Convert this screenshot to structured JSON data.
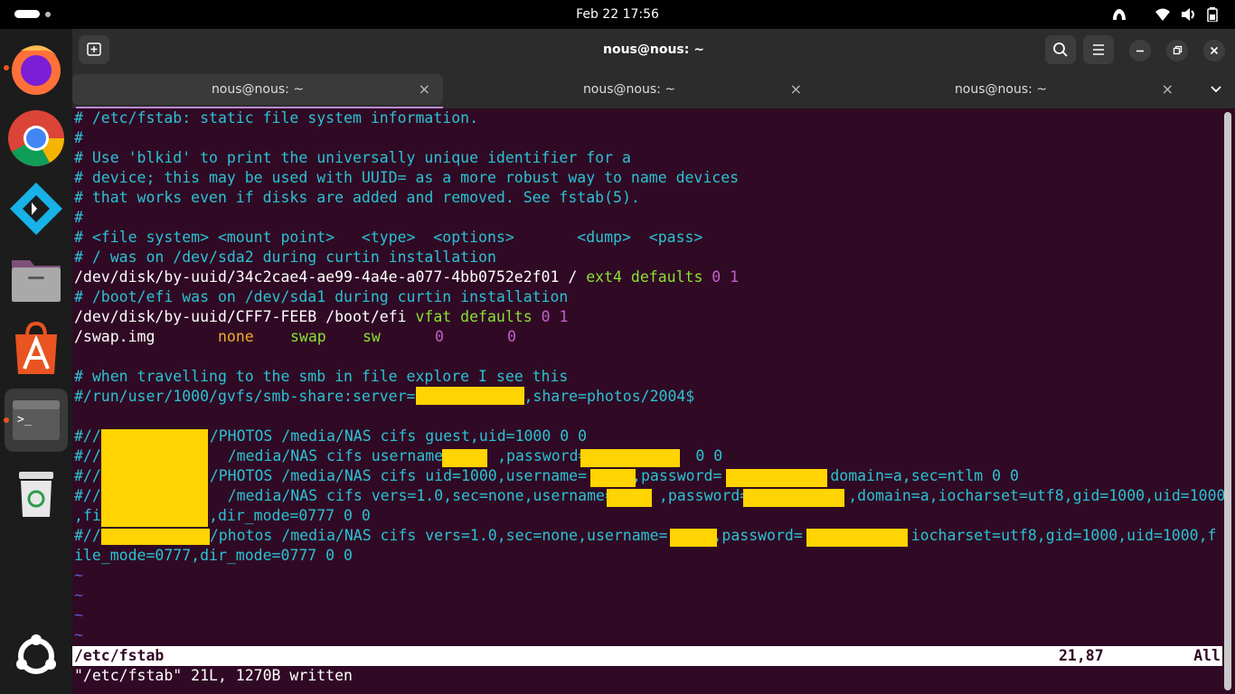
{
  "topbar": {
    "clock": "Feb 22  17:56"
  },
  "dock": {
    "apps": [
      "firefox-icon",
      "chrome-icon",
      "kodi-icon",
      "files-icon",
      "app-center-icon",
      "terminal-icon",
      "trash-icon",
      "show-apps-icon"
    ],
    "terminal_glyph": ">_"
  },
  "window": {
    "title": "nous@nous: ~",
    "tabs": [
      {
        "label": "nous@nous: ~",
        "close": "×"
      },
      {
        "label": "nous@nous: ~",
        "close": "×"
      },
      {
        "label": "nous@nous: ~",
        "close": "×"
      }
    ]
  },
  "terminal": {
    "lines": [
      "# /etc/fstab: static file system information.",
      "#",
      "# Use 'blkid' to print the universally unique identifier for a",
      "# device; this may be used with UUID= as a more robust way to name devices",
      "# that works even if disks are added and removed. See fstab(5).",
      "#",
      "# <file system> <mount point>   <type>  <options>       <dump>  <pass>",
      "# / was on /dev/sda2 during curtin installation",
      [
        "/dev/disk/by-uuid/34c2cae4-ae99-4a4e-a077-4bb0752e2f01 / ",
        "ext4 defaults",
        " 0 1"
      ],
      "# /boot/efi was on /dev/sda1 during curtin installation",
      [
        "/dev/disk/by-uuid/CFF7-FEEB /boot/efi ",
        "vfat defaults",
        " 0 1"
      ],
      [
        "/swap.img",
        "none",
        "swap",
        "sw",
        "0",
        "0"
      ],
      "",
      "# when travelling to the smb in file explore I see this",
      [
        "#/run/user/1000/gvfs/smb-share:server=",
        ",share=photos/2004$"
      ],
      "",
      [
        "#//",
        "/PHOTOS /media/NAS cifs guest,uid=1000 0 0"
      ],
      [
        "#//",
        " /media/NAS cifs username=",
        ",password=",
        " 0 0"
      ],
      [
        "#//",
        "/PHOTOS /media/NAS cifs uid=1000,username=",
        ",password=",
        ",domain=a,sec=ntlm 0 0"
      ],
      [
        "#//",
        " /media/NAS cifs vers=1.0,sec=none,username=",
        ",password=",
        ",domain=a,iocharset=utf8,gid=1000,uid=1000"
      ],
      ",file_mode=0777,dir_mode=0777 0 0",
      [
        "#//",
        "/photos /media/NAS cifs vers=1.0,sec=none,username=",
        ",password=",
        ",iocharset=utf8,gid=1000,uid=1000,f"
      ],
      "ile_mode=0777,dir_mode=0777 0 0",
      "~",
      "~",
      "~",
      "~"
    ],
    "status": {
      "file": "/etc/fstab",
      "position": "21,87",
      "scroll": "All"
    },
    "message": "\"/etc/fstab\" 21L, 1270B written"
  },
  "colors": {
    "terminal_bg": "#300a24",
    "comment": "#2bc2d4",
    "keyword": "#8ae234",
    "number": "#c061cb",
    "none": "#f0ad30",
    "redaction": "#ffd400"
  }
}
